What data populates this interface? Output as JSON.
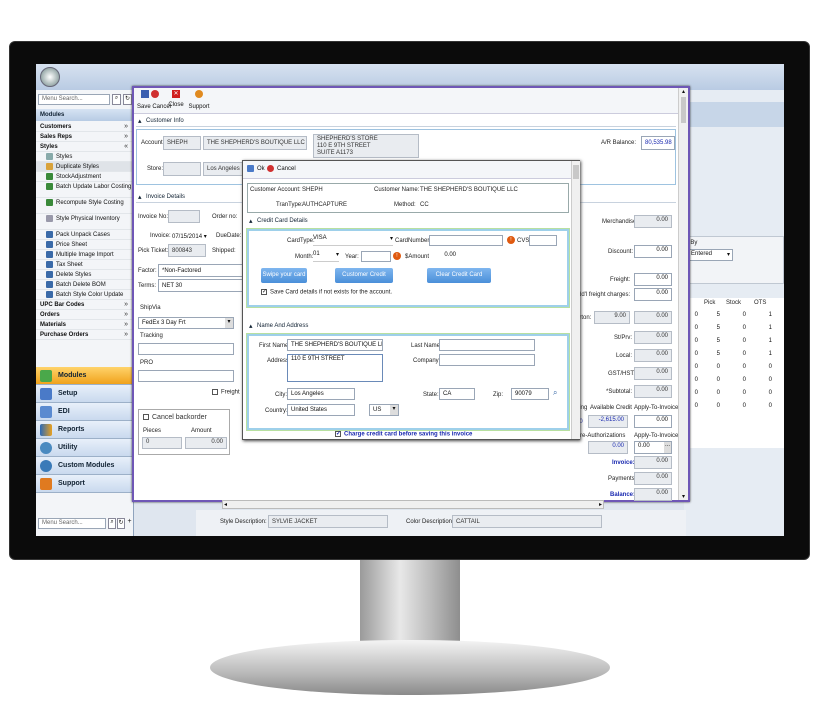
{
  "sidebar": {
    "search_placeholder": "Menu Search...",
    "bottom_search_placeholder": "Menu Search...",
    "modules_header": "Modules",
    "groups": [
      {
        "label": "Customers",
        "chevron": "»"
      },
      {
        "label": "Sales Reps",
        "chevron": "»"
      },
      {
        "label": "Styles",
        "chevron": "«"
      }
    ],
    "style_items": [
      "Styles",
      "Duplicate Styles",
      "StockAdjustment",
      "Batch Update Labor Costing",
      "Recompute Style Costing",
      "Style Physical Inventory",
      "Pack Unpack Cases",
      "Price Sheet",
      "Multiple Image Import",
      "Tax Sheet",
      "Delete Styles",
      "Batch Delete BOM",
      "Batch Style Color Update"
    ],
    "groups2": [
      {
        "label": "UPC Bar Codes",
        "chevron": "»"
      },
      {
        "label": "Orders",
        "chevron": "»"
      },
      {
        "label": "Materials",
        "chevron": "»"
      },
      {
        "label": "Purchase Orders",
        "chevron": "»"
      }
    ],
    "nav": [
      "Modules",
      "Setup",
      "EDI",
      "Reports",
      "Utility",
      "Custom Modules",
      "Support"
    ]
  },
  "toolbar": {
    "save_cancel": "Save Cancel",
    "close": "Close",
    "support": "Support"
  },
  "customer_info": {
    "header": "Customer Info",
    "account_label": "Account:",
    "account_value": "SHEPH",
    "account_name": "THE SHEPHERD'S BOUTIQUE LLC",
    "address_lines": [
      "SHEPHERD'S STORE",
      "110 E 9TH STREET",
      "SUITE A1173"
    ],
    "store_label": "Store:",
    "store_value": "Los Angeles",
    "ar_balance_label": "A/R Balance:",
    "ar_balance_value": "80,535.98"
  },
  "invoice_details": {
    "header": "Invoice Details",
    "invoice_no_label": "Invoice No:",
    "order_no_label": "Order no:",
    "invoice_label": "Invoice:",
    "invoice_date": "07/15/2014",
    "due_date_label": "DueDate:",
    "pick_ticket_label": "Pick Ticket:",
    "pick_ticket_value": "800843",
    "shipped_label": "Shipped:",
    "factor_label": "Factor:",
    "factor_value": "*Non-Factored",
    "terms_label": "Terms:",
    "terms_value": "NET 30",
    "shipvia_label": "ShipVia",
    "shipvia_value": "FedEx 3 Day Frt",
    "tracking_label": "Tracking",
    "pro_label": "PRO",
    "freight_label": "Freight",
    "cancel_backorder": "Cancel backorder",
    "pieces_label": "Pieces",
    "amount_label": "Amount",
    "pieces_value": "0",
    "amount_value": "0.00"
  },
  "totals": {
    "merchandise_label": "Merchandise:",
    "merchandise_value": "0.00",
    "discount_label": "Discount:",
    "discount_value": "0.00",
    "freight_label": "Freight:",
    "freight_value": "0.00",
    "addl_freight_label": "Add'l freight charges:",
    "addl_freight_value": "0.00",
    "carton_label": "arton:",
    "carton_value": "9.00",
    "carton_value2": "0.00",
    "st_prv_label": "St/Prv:",
    "st_prv_value": "0.00",
    "local_label": "Local:",
    "local_value": "0.00",
    "gst_label": "GST/HST:",
    "gst_value": "0.00",
    "subtotal_label": "*Subtotal:",
    "subtotal_value": "0.00",
    "col_ning": "ning",
    "col_available": "Available Credit",
    "col_apply": "Apply-To-Invoice",
    "ning_value": "00",
    "available_value": "-2,615.00",
    "apply_value": "0.00",
    "pre_auth_label": "Pre-Authorizations",
    "pre_auth_apply": "Apply-To-Invoice",
    "pre_auth_value": "0.00",
    "pre_auth_value2": "0.00",
    "invoice_total_label": "Invoice:",
    "invoice_total_value": "0.00",
    "payments_label": "Payments:",
    "payments_value": "0.00",
    "balance_label": "Balance:",
    "balance_value": "0.00"
  },
  "right_panel": {
    "by_label": "t By",
    "entered_value": "Entered",
    "columns": [
      "Pick",
      "Stock",
      "OTS"
    ],
    "rows": [
      [
        "0",
        "5",
        "0",
        "1"
      ],
      [
        "0",
        "5",
        "0",
        "1"
      ],
      [
        "0",
        "5",
        "0",
        "1"
      ],
      [
        "0",
        "5",
        "0",
        "1"
      ],
      [
        "0",
        "0",
        "0",
        "0"
      ],
      [
        "0",
        "0",
        "0",
        "0"
      ],
      [
        "0",
        "0",
        "0",
        "0"
      ],
      [
        "0",
        "0",
        "0",
        "0"
      ]
    ]
  },
  "footer": {
    "style_desc_label": "Style Description:",
    "style_desc_value": "SYLVIE JACKET",
    "color_desc_label": "Color Description:",
    "color_desc_value": "CATTAIL"
  },
  "dialog": {
    "ok": "Ok",
    "cancel": "Cancel",
    "customer_account_label": "Customer Account:",
    "customer_account_value": "SHEPH",
    "customer_name_label": "Customer Name:",
    "customer_name_value": "THE SHEPHERD'S BOUTIQUE LLC",
    "trantype_label": "TranType:",
    "trantype_value": "AUTHCAPTURE",
    "method_label": "Method:",
    "method_value": "CC",
    "cc_header": "Credit Card Details",
    "cardtype_label": "CardType:",
    "cardtype_value": "VISA",
    "cardnumber_label": "CardNumber:",
    "cvs_label": "CVS:",
    "month_label": "Month:",
    "month_value": "01",
    "year_label": "Year:",
    "amount_label": "$Amount:",
    "amount_value": "0.00",
    "swipe_btn": "Swipe your card",
    "customer_cc_btn": "Customer Credit Card",
    "clear_btn": "Clear Credit Card Details",
    "save_card_label": "Save Card details if not exists for the account.",
    "name_header": "Name And Address",
    "first_name_label": "First Name:",
    "first_name_value": "THE SHEPHERD'S BOUTIQUE LLC",
    "last_name_label": "Last Name:",
    "address_label": "Address:",
    "address_value": "110 E 9TH STREET",
    "company_label": "Company:",
    "city_label": "City:",
    "city_value": "Los Angeles",
    "state_label": "State:",
    "state_value": "CA",
    "zip_label": "Zip:",
    "zip_value": "90079",
    "country_label": "Country:",
    "country_value": "United States",
    "country_code": "US",
    "charge_label": "Charge credit card before saving this invoice"
  }
}
